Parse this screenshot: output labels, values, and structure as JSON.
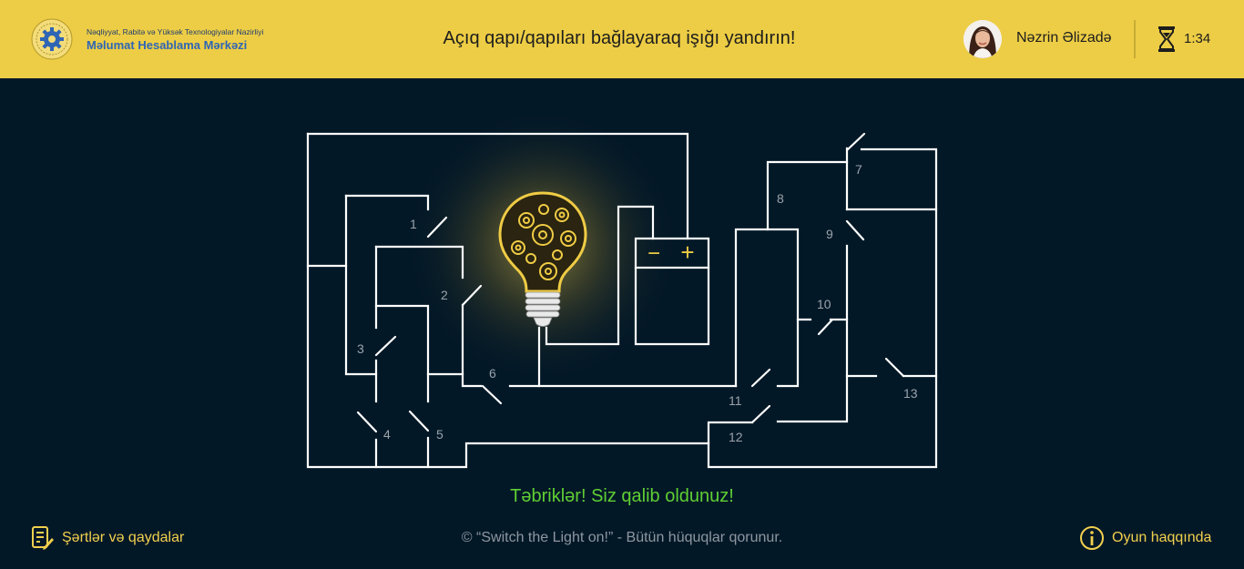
{
  "header": {
    "ministry": "Nəqliyyat, Rabitə və Yüksək Texnologiyalar Nazirliyi",
    "center": "Məlumat Hesablama Mərkəzi",
    "task": "Açıq qapı/qapıları bağlayaraq işığı yandırın!",
    "user_name": "Nəzrin Əlizadə",
    "timer": "1:34"
  },
  "game": {
    "doors": [
      "1",
      "2",
      "3",
      "4",
      "5",
      "6",
      "7",
      "8",
      "9",
      "10",
      "11",
      "12",
      "13"
    ],
    "battery_minus": "−",
    "battery_plus": "+",
    "bulb_state": "on"
  },
  "result": {
    "message": "Təbriklər! Siz qalib oldunuz!"
  },
  "footer": {
    "rules": "Şərtlər və qaydalar",
    "copyright": "© “Switch the Light on!” - Bütün hüquqlar qorunur.",
    "about": "Oyun haqqında"
  },
  "colors": {
    "header_bg": "#edcd45",
    "page_bg": "#031827",
    "accent": "#f2d04d",
    "success": "#5fcf33",
    "wire": "#ffffff"
  },
  "icons": [
    "ministry-logo",
    "avatar",
    "hourglass-icon",
    "lightbulb-icon",
    "battery-icon",
    "rules-icon",
    "info-icon"
  ]
}
